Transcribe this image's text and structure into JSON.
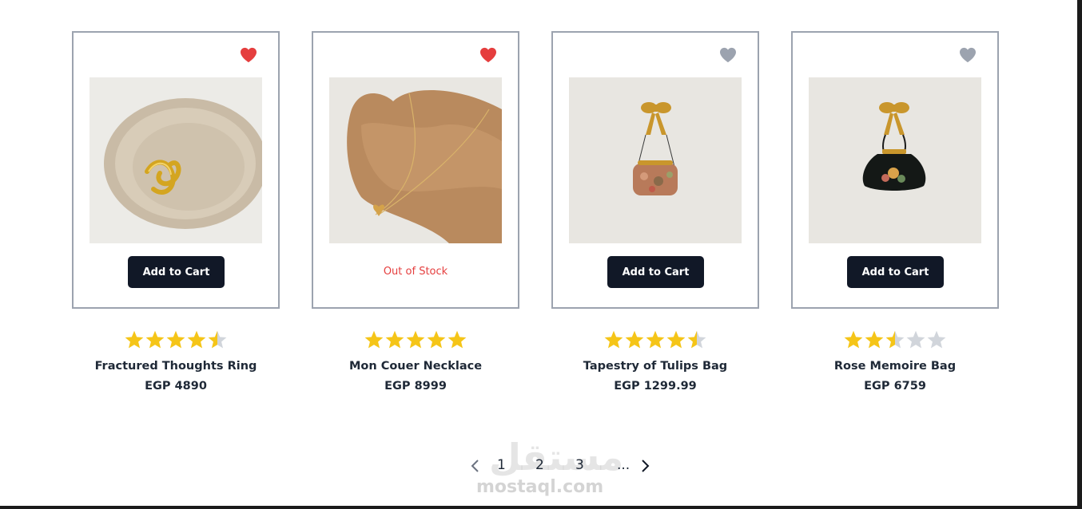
{
  "products": [
    {
      "name": "Fractured Thoughts Ring",
      "currency": "EGP",
      "price": "4890",
      "rating": 4.5,
      "favorited": true,
      "in_stock": true,
      "action_label": "Add to Cart"
    },
    {
      "name": "Mon Couer Necklace",
      "currency": "EGP",
      "price": "8999",
      "rating": 5,
      "favorited": true,
      "in_stock": false,
      "status_label": "Out of Stock"
    },
    {
      "name": "Tapestry of Tulips Bag",
      "currency": "EGP",
      "price": "1299.99",
      "rating": 4.5,
      "favorited": false,
      "in_stock": true,
      "action_label": "Add to Cart"
    },
    {
      "name": "Rose Memoire Bag",
      "currency": "EGP",
      "price": "6759",
      "rating": 2.5,
      "favorited": false,
      "in_stock": true,
      "action_label": "Add to Cart"
    }
  ],
  "pagination": {
    "prev_icon": "chevron-left-icon",
    "pages": [
      "1",
      "2",
      "3"
    ],
    "ellipsis": "...",
    "next_icon": "chevron-right-icon"
  },
  "watermark": {
    "arabic": "مستقل",
    "latin": "mostaql.com"
  },
  "colors": {
    "heart_active": "#e53e3e",
    "heart_inactive": "#9ca3af",
    "star_filled": "#f5c518",
    "star_empty": "#d1d5db",
    "button_bg": "#111827",
    "out_of_stock": "#e53e3e"
  }
}
